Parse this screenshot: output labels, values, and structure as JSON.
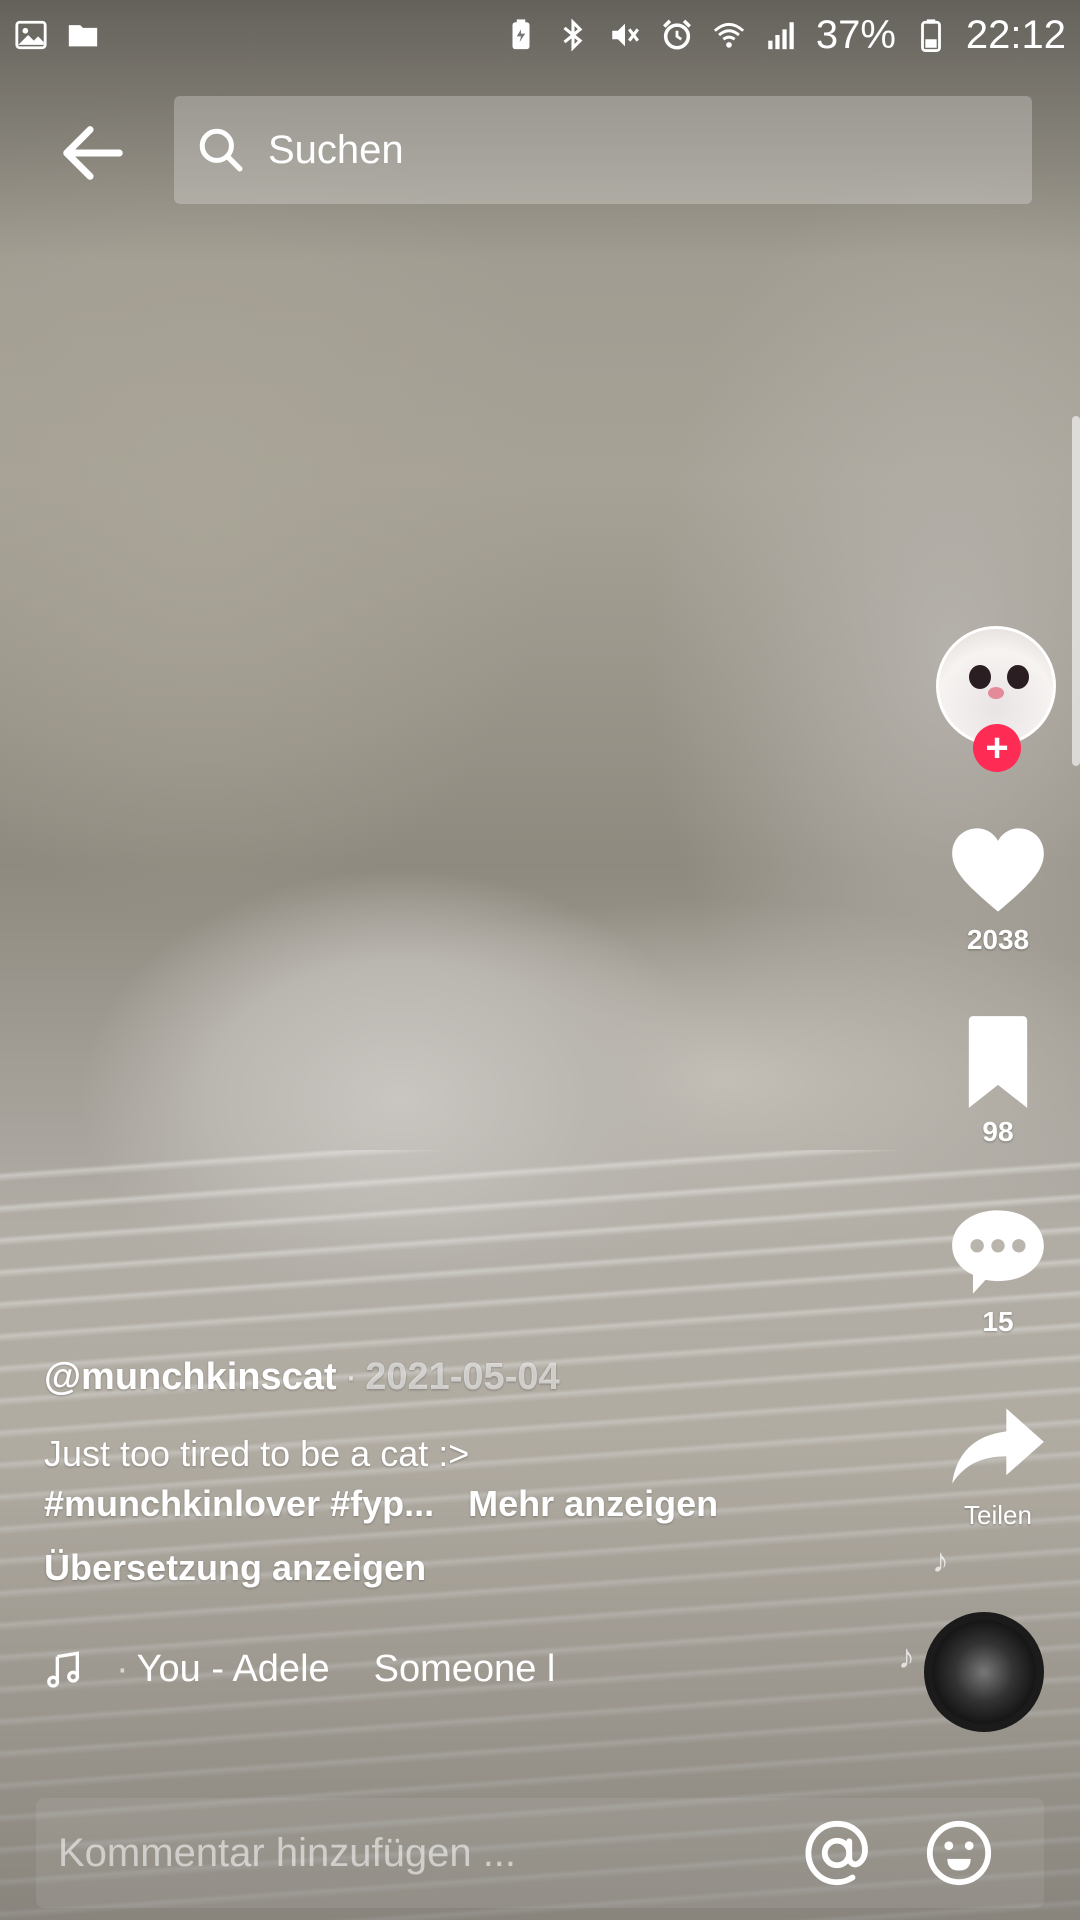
{
  "status_bar": {
    "battery": "37%",
    "time": "22:12",
    "left_icons": [
      "image-icon",
      "folder-icon"
    ],
    "right_icons": [
      "battery-saver-icon",
      "bluetooth-icon",
      "mute-icon",
      "alarm-icon",
      "wifi-icon",
      "signal-icon",
      "battery-icon"
    ]
  },
  "header": {
    "search_placeholder": "Suchen"
  },
  "video": {
    "author": "@munchkinscat",
    "date": "2021-05-04",
    "description": "Just too tired to be a cat :>",
    "hashtags": "#munchkinlover #fyp...",
    "more_label": "Mehr anzeigen",
    "translate_label": "Übersetzung anzeigen",
    "music": {
      "track_a": "You - Adele",
      "track_b": "Someone l"
    }
  },
  "actions": {
    "likes": "2038",
    "saves": "98",
    "comments": "15",
    "share_label": "Teilen"
  },
  "comment_bar": {
    "placeholder": "Kommentar hinzufügen ..."
  },
  "colors": {
    "accent": "#fe2c55"
  }
}
